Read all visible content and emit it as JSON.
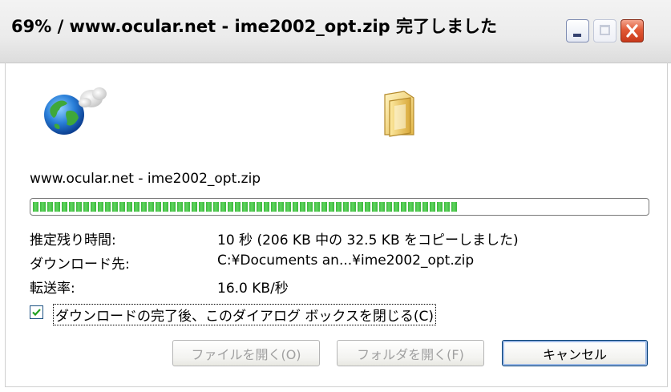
{
  "window": {
    "title": "69% / www.ocular.net - ime2002_opt.zip 完了しました"
  },
  "download": {
    "source": "www.ocular.net - ime2002_opt.zip",
    "progress_fraction": 0.69
  },
  "info": {
    "time_remaining_label": "推定残り時間:",
    "time_remaining_value": "10 秒 (206 KB 中の 32.5 KB をコピーしました)",
    "destination_label": "ダウンロード先:",
    "destination_value": "C:¥Documents an...¥ime2002_opt.zip",
    "transfer_rate_label": "転送率:",
    "transfer_rate_value": "16.0 KB/秒"
  },
  "options": {
    "close_on_complete_label": "ダウンロードの完了後、このダイアログ ボックスを閉じる(C)",
    "close_on_complete_checked": true
  },
  "buttons": {
    "open_file": "ファイルを開く(O)",
    "open_folder": "フォルダを開く(F)",
    "cancel": "キャンセル"
  },
  "icons": {
    "globe": "globe-icon",
    "folder": "folder-icon",
    "minimize": "minimize-icon",
    "maximize": "maximize-icon",
    "close": "close-icon"
  }
}
